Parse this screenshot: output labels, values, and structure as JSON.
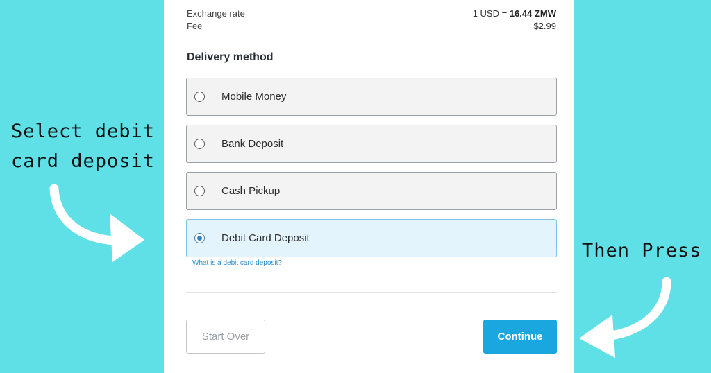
{
  "summary": {
    "exchange_label": "Exchange rate",
    "exchange_prefix": "1 USD = ",
    "exchange_value": "16.44 ZMW",
    "fee_label": "Fee",
    "fee_value": "$2.99"
  },
  "delivery": {
    "title": "Delivery method",
    "options": [
      {
        "label": "Mobile Money",
        "selected": false
      },
      {
        "label": "Bank Deposit",
        "selected": false
      },
      {
        "label": "Cash Pickup",
        "selected": false
      },
      {
        "label": "Debit Card Deposit",
        "selected": true
      }
    ],
    "help_link": "What is a debit card deposit?"
  },
  "buttons": {
    "start_over": "Start Over",
    "continue": "Continue"
  },
  "annotations": {
    "left_line1": "Select debit",
    "left_line2": "card deposit",
    "right": "Then Press"
  },
  "colors": {
    "background": "#5fe0e6",
    "accent": "#1aa7e0",
    "selected_bg": "#e4f4fd"
  }
}
